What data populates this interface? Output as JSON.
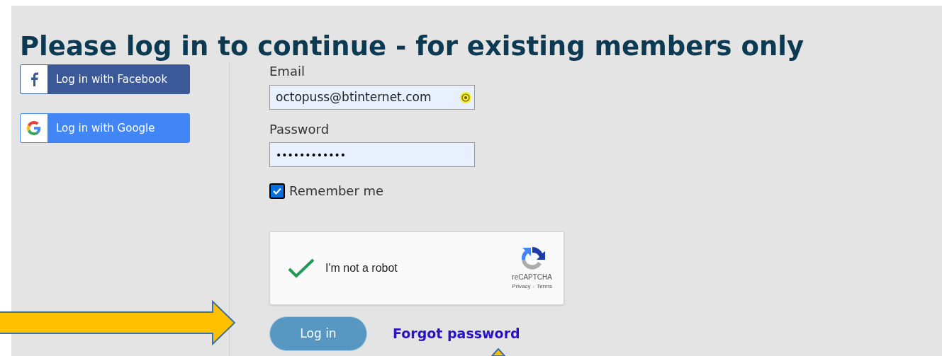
{
  "heading": "Please log in to continue - for existing members only",
  "social_buttons": [
    {
      "kind": "facebook",
      "label": "Log in with Facebook"
    },
    {
      "kind": "google",
      "label": "Log in with Google"
    }
  ],
  "email": {
    "label": "Email",
    "value": "octopuss@btinternet.com"
  },
  "password": {
    "label": "Password",
    "value": "••••••••••••"
  },
  "remember": {
    "label": "Remember me",
    "checked": true
  },
  "captcha": {
    "label": "I'm not a robot",
    "checked": true,
    "brand": "reCAPTCHA",
    "privacy": "Privacy",
    "separator": "-",
    "terms": "Terms"
  },
  "login_button": "Log in",
  "forgot_link": "Forgot password"
}
